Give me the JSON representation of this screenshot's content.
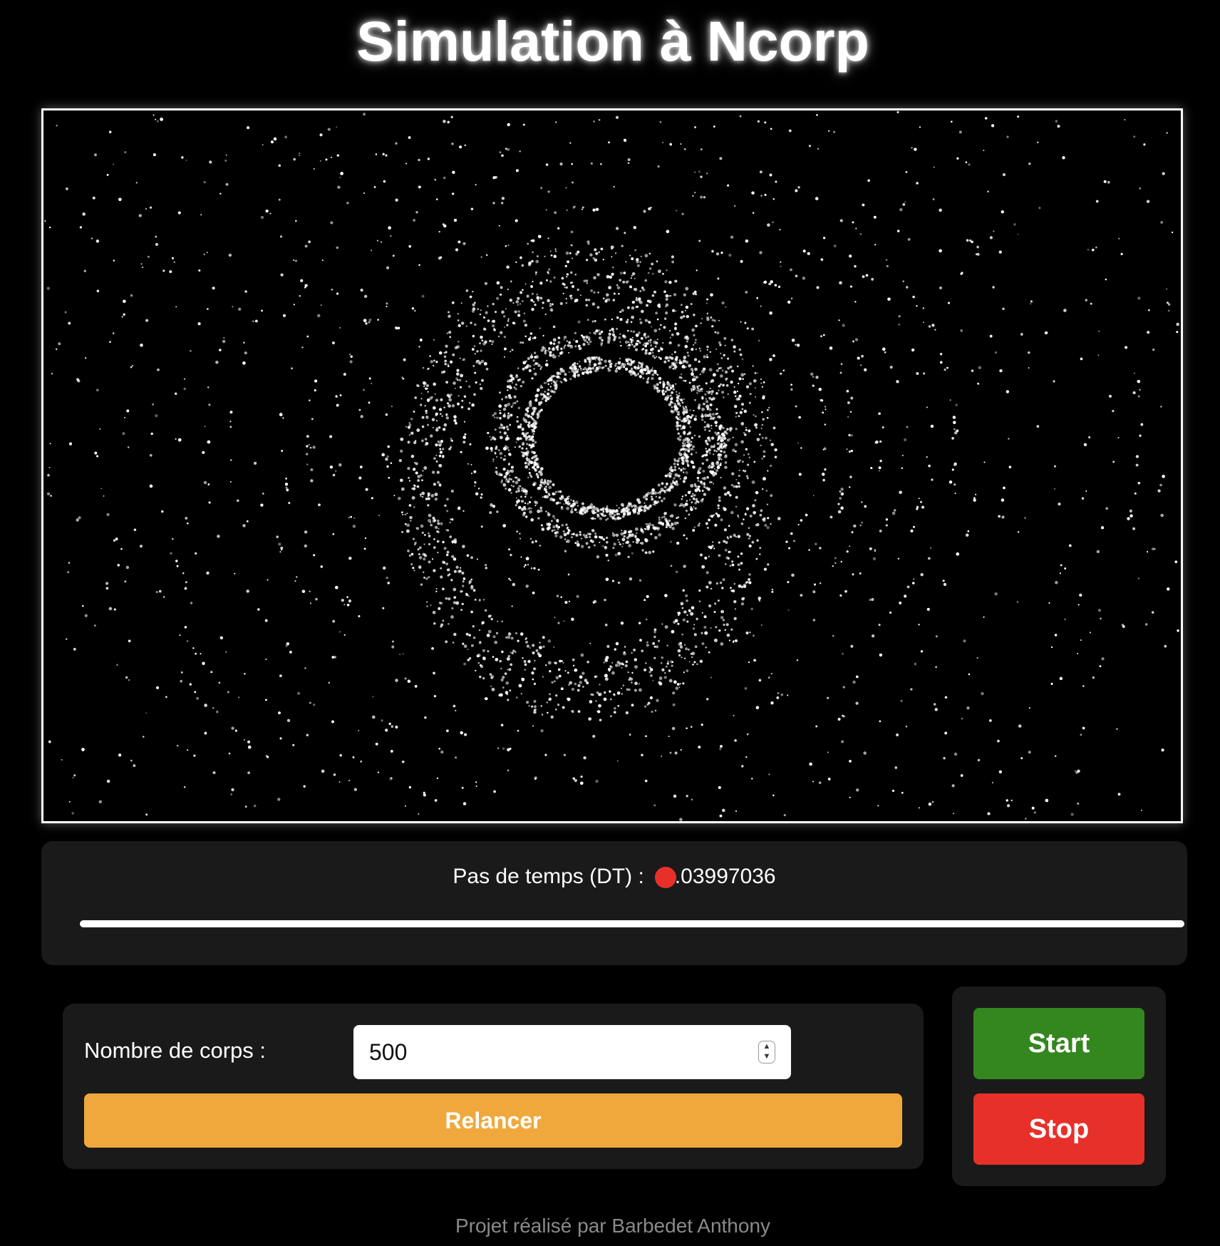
{
  "title": "Simulation à Ncorp",
  "simulation": {
    "description_note": ""
  },
  "dt_control": {
    "label": "Pas de temps (DT) :",
    "value": "0.03997036",
    "slider_fraction": 0.53,
    "thumb_color": "#e8302a"
  },
  "bodies_control": {
    "label": "Nombre de corps :",
    "value": "500",
    "relaunch_label": "Relancer",
    "relaunch_color": "#f0a83c"
  },
  "buttons": {
    "start_label": "Start",
    "start_color": "#34861f",
    "stop_label": "Stop",
    "stop_color": "#e8302a"
  },
  "footer": "Projet réalisé par Barbedet Anthony",
  "icons": {
    "spinner": "number-spinner-icon"
  }
}
